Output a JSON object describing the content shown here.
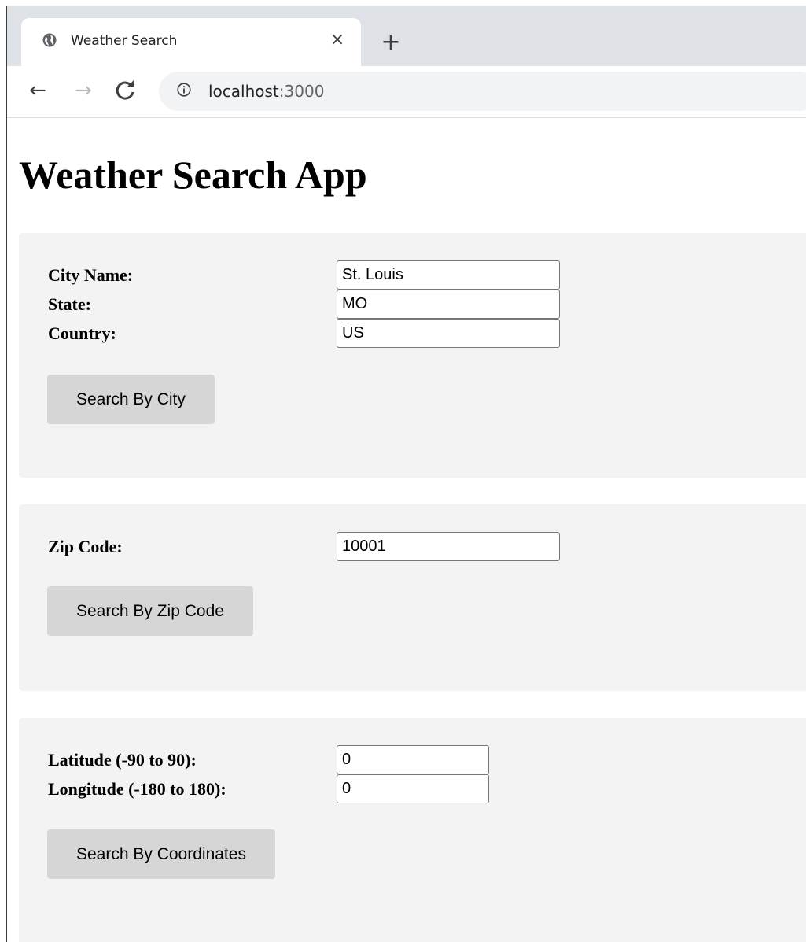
{
  "browser": {
    "tab_title": "Weather Search",
    "tab_close_symbol": "×",
    "new_tab_symbol": "+",
    "back_symbol": "←",
    "forward_symbol": "→",
    "reload_symbol": "C",
    "url_host": "localhost",
    "url_port": ":3000"
  },
  "page": {
    "title": "Weather Search App"
  },
  "city_form": {
    "city_label": "City Name:",
    "city_value": "St. Louis",
    "state_label": "State:",
    "state_value": "MO",
    "country_label": "Country:",
    "country_value": "US",
    "button_label": "Search By City"
  },
  "zip_form": {
    "zip_label": "Zip Code:",
    "zip_value": "10001",
    "button_label": "Search By Zip Code"
  },
  "coords_form": {
    "lat_label": "Latitude (-90 to 90):",
    "lat_value": "0",
    "lon_label": "Longitude (-180 to 180):",
    "lon_value": "0",
    "button_label": "Search By Coordinates"
  },
  "icons": {
    "favicon": "globe-icon",
    "site_info": "info-icon"
  }
}
